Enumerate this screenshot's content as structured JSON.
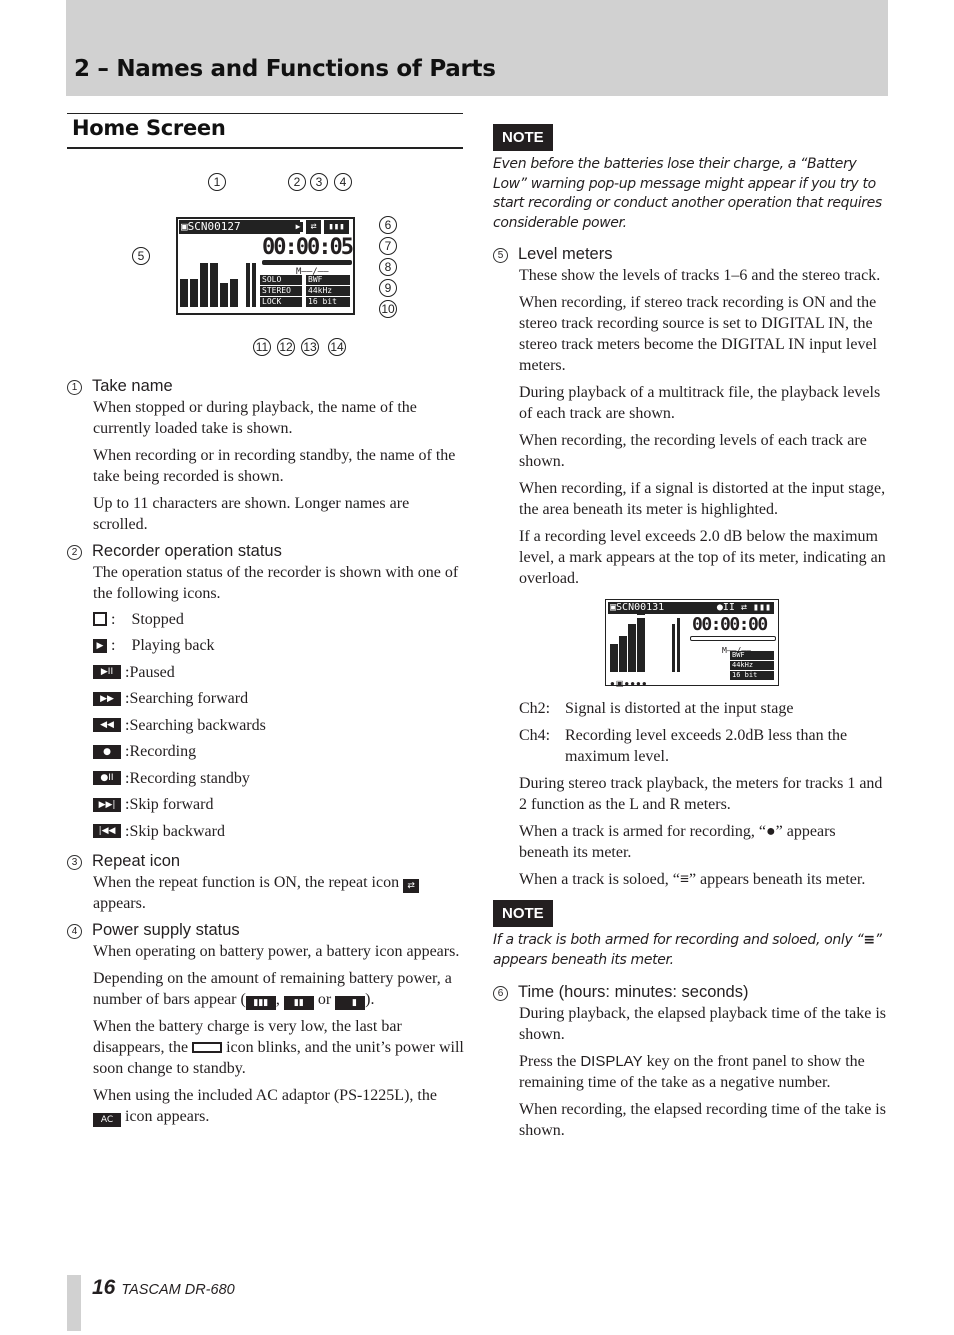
{
  "header": {
    "chapter_title": "2 – Names and Functions of Parts"
  },
  "section": {
    "title": "Home Screen"
  },
  "diagram": {
    "callouts": [
      "1",
      "2",
      "3",
      "4",
      "5",
      "6",
      "7",
      "8",
      "9",
      "10",
      "11",
      "12",
      "13",
      "14"
    ],
    "take_name": "SCN00127",
    "time": "00:00:05",
    "mark": "M––/––",
    "labels": {
      "solo": "SOLO",
      "stereo": "STEREO",
      "lock": "LOCK",
      "format": "BWF",
      "rate": "44kHz",
      "bits": "16 bit"
    }
  },
  "left": {
    "items": [
      {
        "num": "1",
        "title": "Take name",
        "paras": [
          "When stopped or during playback, the name of the currently loaded take is shown.",
          "When recording or in recording standby, the name of the take being recorded is shown.",
          "Up to 11 characters are shown. Longer names are scrolled."
        ]
      },
      {
        "num": "2",
        "title": "Recorder operation status",
        "paras": [
          "The operation status of the recorder is shown with one of the following icons."
        ]
      },
      {
        "num": "3",
        "title": "Repeat icon",
        "para_before": "When the repeat function is ON, the repeat icon",
        "para_after": "appears."
      },
      {
        "num": "4",
        "title": "Power supply status",
        "paras": [
          "When operating on battery power, a battery icon appears."
        ],
        "bars_before": "Depending on the amount of remaining battery power, a number of bars appear (",
        "bars_sep1": ", ",
        "bars_sep2": " or ",
        "bars_after": ").",
        "low_before": "When the battery charge is very low, the last bar disappears, the",
        "low_after": "icon blinks, and the unit’s power will soon change to standby.",
        "ac_before": "When using the included AC adaptor (PS-1225L), the",
        "ac_after": "icon appears."
      }
    ],
    "status_icons": [
      {
        "icon": "stop-icon",
        "glyph": "■",
        "label": "Stopped"
      },
      {
        "icon": "play-icon",
        "glyph": "▶",
        "label": "Playing back"
      },
      {
        "icon": "pause-icon",
        "glyph": "▶II",
        "label": "Paused"
      },
      {
        "icon": "search-forward-icon",
        "glyph": "▶▶",
        "label": "Searching forward"
      },
      {
        "icon": "search-backward-icon",
        "glyph": "◀◀",
        "label": "Searching backwards"
      },
      {
        "icon": "record-icon",
        "glyph": "●",
        "label": "Recording"
      },
      {
        "icon": "record-standby-icon",
        "glyph": "●II",
        "label": "Recording standby"
      },
      {
        "icon": "skip-forward-icon",
        "glyph": "▶▶|",
        "label": "Skip forward"
      },
      {
        "icon": "skip-backward-icon",
        "glyph": "|◀◀",
        "label": "Skip backward"
      }
    ],
    "repeat_glyph": "⇄",
    "ac_glyph": "AC"
  },
  "right": {
    "note1": {
      "badge": "NOTE",
      "text": "Even before the batteries lose their charge, a “Battery Low” warning pop-up message might appear if you try to start recording or conduct another operation that requires considerable power."
    },
    "item5": {
      "num": "5",
      "title": "Level meters",
      "paras": [
        "These show the levels of tracks 1–6 and the stereo track.",
        "When recording, if stereo track recording is ON and the stereo track recording source is set to DIGITAL IN, the stereo track meters become the DIGITAL IN input level meters.",
        "During playback of a multitrack file, the playback levels of each track are shown.",
        "When recording, the recording levels of each track are shown.",
        "When recording, if a signal is distorted at the input stage, the area beneath its meter is highlighted.",
        "If a recording level exceeds 2.0 dB below the maximum level, a mark appears at the top of its meter, indicating an overload."
      ]
    },
    "lcd2": {
      "take_name": "SCN00131",
      "time": "00:00:00",
      "mark": "M––/––",
      "format": "BWF",
      "rate": "44kHz",
      "bits": "16 bit"
    },
    "channels": [
      {
        "ch": "Ch2:",
        "text": "Signal is distorted at the input stage"
      },
      {
        "ch": "Ch4:",
        "text": "Recording level exceeds 2.0dB less than the maximum level."
      }
    ],
    "paras_after": [
      "During stereo track playback, the meters for tracks 1 and 2 function as the L and R meters.",
      "When a track is armed for recording, “●” appears beneath its meter."
    ],
    "solo_before": "When a track is soloed, “",
    "solo_after": "” appears beneath its meter.",
    "note2": {
      "badge": "NOTE",
      "text_before": "If a track is both armed for recording and soloed, only “",
      "text_after": "” appears beneath its meter."
    },
    "item6": {
      "num": "6",
      "title": "Time (hours: minutes: seconds)",
      "p1": "During playback, the elapsed playback time of the take is shown.",
      "p2_before": "Press the ",
      "p2_key": "DISPLAY",
      "p2_after": " key on the front panel to show the remaining time of the take as a negative number.",
      "p3": "When recording, the elapsed recording time of the take is shown."
    },
    "solo_glyph": "≡"
  },
  "footer": {
    "page": "16",
    "model": "TASCAM  DR-680"
  }
}
